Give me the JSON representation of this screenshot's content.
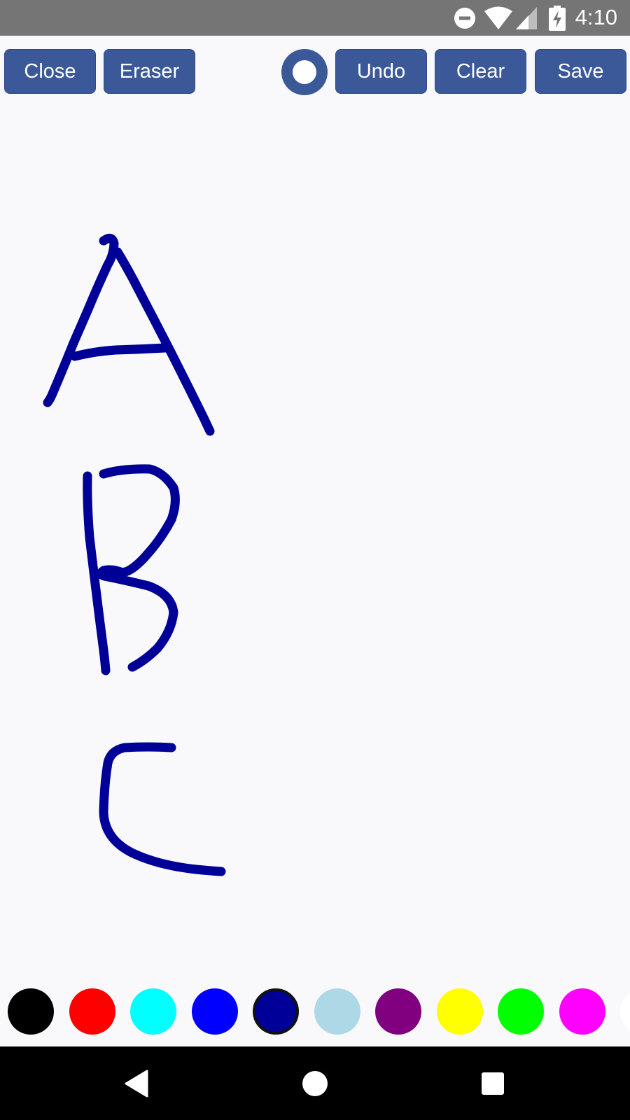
{
  "status_bar": {
    "time": "4:10",
    "icons": [
      "do-not-disturb-icon",
      "wifi-icon",
      "cell-signal-icon",
      "battery-charging-icon"
    ]
  },
  "toolbar": {
    "close_label": "Close",
    "eraser_label": "Eraser",
    "undo_label": "Undo",
    "clear_label": "Clear",
    "save_label": "Save",
    "brush_size_icon": "brush-size-icon"
  },
  "canvas": {
    "stroke_color": "#000099",
    "strokes_depict": [
      "A",
      "B",
      "C"
    ]
  },
  "palette": {
    "colors": [
      "#000000",
      "#ff0000",
      "#00ffff",
      "#0000ff",
      "#000099",
      "#add8e6",
      "#800080",
      "#ffff00",
      "#00ff00",
      "#ff00ff",
      "#ffffff"
    ],
    "selected_color": "#000099"
  },
  "nav_bar": {
    "icons": [
      "back-icon",
      "home-icon",
      "recents-icon"
    ]
  },
  "theme": {
    "button_color": "#3b5998",
    "status_bar_color": "#757575",
    "canvas_background": "#f9f9fb"
  }
}
